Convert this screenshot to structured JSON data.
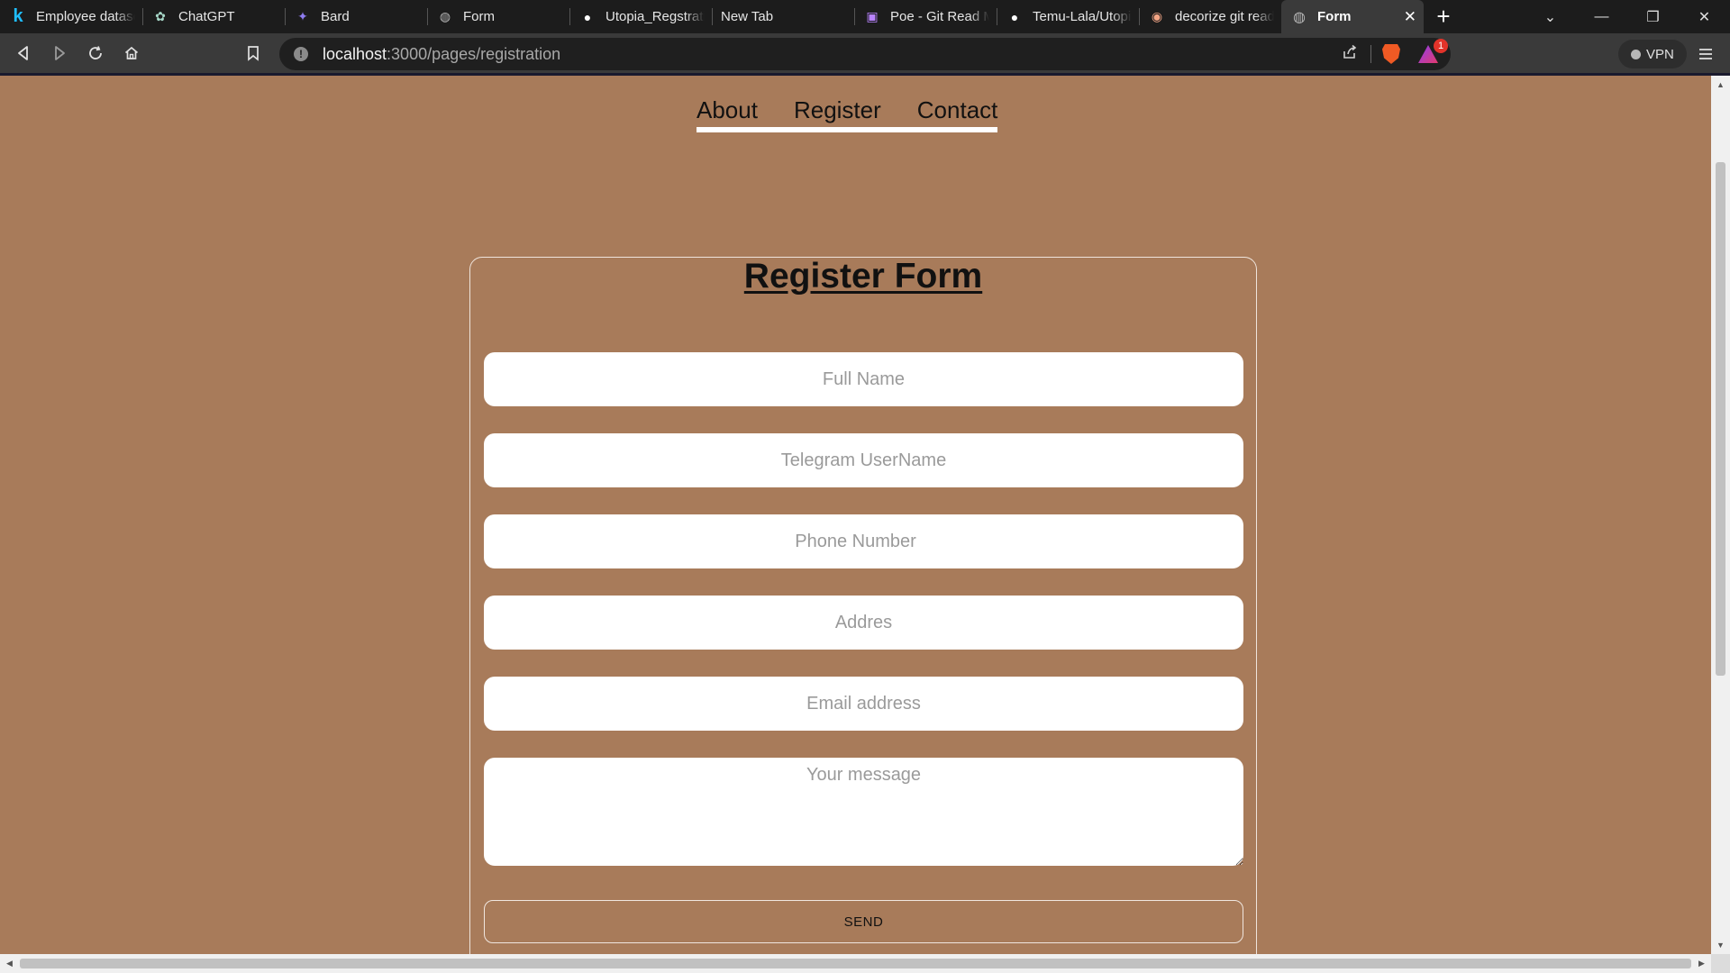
{
  "browser": {
    "tabs": [
      {
        "label": "Employee datase",
        "icon": "kaggle-icon",
        "glyph": "k",
        "color": "#20beff"
      },
      {
        "label": "ChatGPT",
        "icon": "chatgpt-icon",
        "glyph": "✿",
        "color": "#a7d8c8"
      },
      {
        "label": "Bard",
        "icon": "bard-sparkle-icon",
        "glyph": "✦",
        "color": "#8e7cf0"
      },
      {
        "label": "Form",
        "icon": "globe-icon",
        "glyph": "◍",
        "color": "#b5b5b5"
      },
      {
        "label": "Utopia_Regstratio",
        "icon": "github-icon",
        "glyph": "●",
        "color": "#ffffff"
      },
      {
        "label": "New Tab",
        "icon": "",
        "glyph": "",
        "color": ""
      },
      {
        "label": "Poe - Git Read M",
        "icon": "poe-icon",
        "glyph": "▣",
        "color": "#b983ff"
      },
      {
        "label": "Temu-Lala/Utopi",
        "icon": "github-icon",
        "glyph": "●",
        "color": "#ffffff"
      },
      {
        "label": "decorize git read",
        "icon": "brave-search-icon",
        "glyph": "◉",
        "color": "#f3a585"
      }
    ],
    "active_tab": {
      "label": "Form",
      "icon": "globe-icon",
      "glyph": "◍",
      "color": "#b5b5b5"
    },
    "url_host": "localhost",
    "url_path": ":3000/pages/registration",
    "rewards_badge": "1",
    "vpn_label": "VPN"
  },
  "nav": {
    "about": "About",
    "register": "Register",
    "contact": "Contact"
  },
  "form": {
    "title": "Register Form",
    "full_name_placeholder": "Full Name",
    "telegram_placeholder": "Telegram UserName",
    "phone_placeholder": "Phone Number",
    "address_placeholder": "Addres",
    "email_placeholder": "Email address",
    "message_placeholder": "Your message",
    "send_label": "SEND"
  },
  "colors": {
    "page_background": "#a87b5a",
    "tab_bar": "#1c1c1c",
    "toolbar": "#3a3a3a"
  }
}
